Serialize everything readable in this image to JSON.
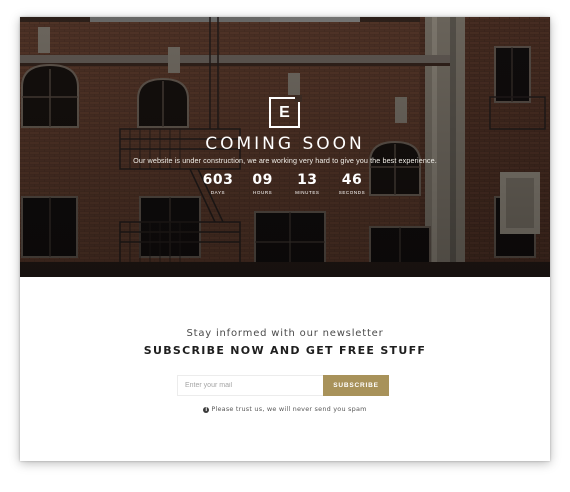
{
  "logo": {
    "letter": "E"
  },
  "hero": {
    "headline": "COMING SOON",
    "subline": "Our website is under construction, we are working very hard to give you the best experience."
  },
  "countdown": [
    {
      "value": "603",
      "label": "DAYS"
    },
    {
      "value": "09",
      "label": "HOURS"
    },
    {
      "value": "13",
      "label": "MINUTES"
    },
    {
      "value": "46",
      "label": "SECONDS"
    }
  ],
  "newsletter": {
    "intro": "Stay informed with our newsletter",
    "title": "SUBSCRIBE NOW AND GET FREE STUFF",
    "email_placeholder": "Enter your mail",
    "email_value": "",
    "subscribe_label": "SUBSCRIBE",
    "note": "Please trust us, we will never send you spam",
    "note_icon": "info-circle-icon"
  },
  "colors": {
    "accent": "#a8925a",
    "hero_overlay": "#2b1f1a",
    "text_dark": "#1e1e1e"
  }
}
